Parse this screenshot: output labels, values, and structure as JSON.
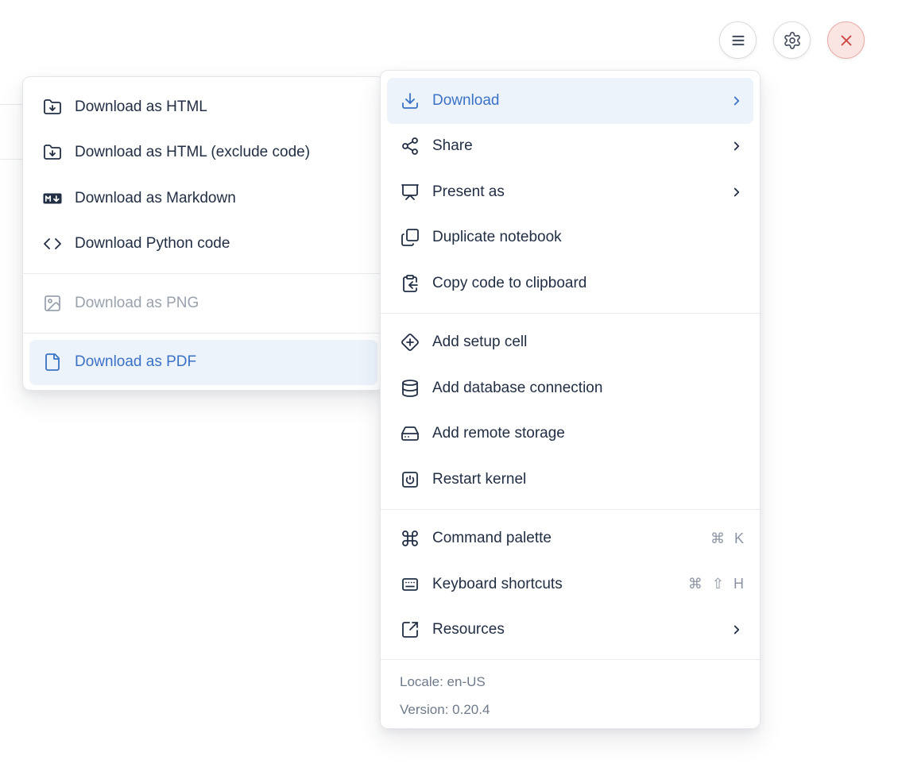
{
  "toolbar": {
    "buttons": [
      {
        "id": "notebook-menu",
        "icon": "hamburger-icon"
      },
      {
        "id": "settings",
        "icon": "gear-icon"
      },
      {
        "id": "close-app",
        "icon": "close-icon"
      }
    ]
  },
  "main_menu": {
    "items": [
      {
        "label": "Download",
        "icon": "download-icon",
        "has_submenu": true,
        "state": "active"
      },
      {
        "label": "Share",
        "icon": "share-icon",
        "has_submenu": true
      },
      {
        "label": "Present as",
        "icon": "presentation-icon",
        "has_submenu": true
      },
      {
        "label": "Duplicate notebook",
        "icon": "copy-pages-icon"
      },
      {
        "label": "Copy code to clipboard",
        "icon": "clipboard-arrow-icon"
      },
      {
        "label": "Add setup cell",
        "icon": "diamond-plus-icon"
      },
      {
        "label": "Add database connection",
        "icon": "database-icon"
      },
      {
        "label": "Add remote storage",
        "icon": "hard-drive-icon"
      },
      {
        "label": "Restart kernel",
        "icon": "power-square-icon"
      },
      {
        "label": "Command palette",
        "icon": "command-icon",
        "shortcut": "⌘ K"
      },
      {
        "label": "Keyboard shortcuts",
        "icon": "keyboard-icon",
        "shortcut": "⌘ ⇧ H"
      },
      {
        "label": "Resources",
        "icon": "external-link-icon",
        "has_submenu": true
      }
    ],
    "footer": {
      "locale": "Locale: en-US",
      "version": "Version: 0.20.4"
    }
  },
  "download_submenu": {
    "items": [
      {
        "label": "Download as HTML",
        "icon": "folder-down-icon"
      },
      {
        "label": "Download as HTML (exclude code)",
        "icon": "folder-down-icon"
      },
      {
        "label": "Download as Markdown",
        "icon": "markdown-badge-icon"
      },
      {
        "label": "Download Python code",
        "icon": "code-brackets-icon"
      },
      {
        "label": "Download as PNG",
        "icon": "image-icon",
        "state": "disabled"
      },
      {
        "label": "Download as PDF",
        "icon": "file-icon",
        "state": "active"
      }
    ]
  },
  "colors": {
    "accent_blue": "#3b72c6",
    "active_row_bg": "#ecf3fb",
    "text_dark": "#212e44",
    "text_muted": "#6e7a8a",
    "danger_red": "#ce4040",
    "danger_bg": "#fae5e3"
  }
}
